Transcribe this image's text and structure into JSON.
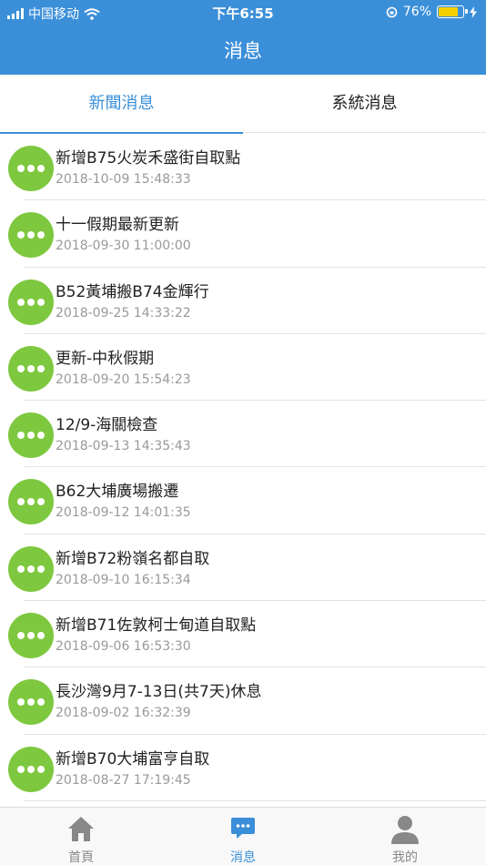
{
  "status_bar": {
    "carrier": "中国移动",
    "time": "下午6:55",
    "battery": "76%",
    "battery_level": 0.76
  },
  "nav": {
    "title": "消息"
  },
  "tabs": [
    {
      "label": "新聞消息",
      "active": true
    },
    {
      "label": "系統消息",
      "active": false
    }
  ],
  "messages": [
    {
      "title": "新增B75火炭禾盛街自取點",
      "date": "2018-10-09 15:48:33"
    },
    {
      "title": "十一假期最新更新",
      "date": "2018-09-30 11:00:00"
    },
    {
      "title": "B52黃埔搬B74金輝行",
      "date": "2018-09-25 14:33:22"
    },
    {
      "title": "更新-中秋假期",
      "date": "2018-09-20 15:54:23"
    },
    {
      "title": "12/9-海關檢查",
      "date": "2018-09-13 14:35:43"
    },
    {
      "title": "B62大埔廣場搬遷",
      "date": "2018-09-12 14:01:35"
    },
    {
      "title": "新增B72粉嶺名都自取",
      "date": "2018-09-10 16:15:34"
    },
    {
      "title": "新增B71佐敦柯士甸道自取點",
      "date": "2018-09-06 16:53:30"
    },
    {
      "title": "長沙灣9月7-13日(共7天)休息",
      "date": "2018-09-02 16:32:39"
    },
    {
      "title": "新增B70大埔富亨自取",
      "date": "2018-08-27 17:19:45"
    }
  ],
  "tabbar": [
    {
      "label": "首頁",
      "icon": "home-icon",
      "active": false
    },
    {
      "label": "消息",
      "icon": "chat-icon",
      "active": true
    },
    {
      "label": "我的",
      "icon": "user-icon",
      "active": false
    }
  ],
  "colors": {
    "primary": "#3b8fd9",
    "bubble": "#7ec83f",
    "battery": "#f5d000"
  }
}
